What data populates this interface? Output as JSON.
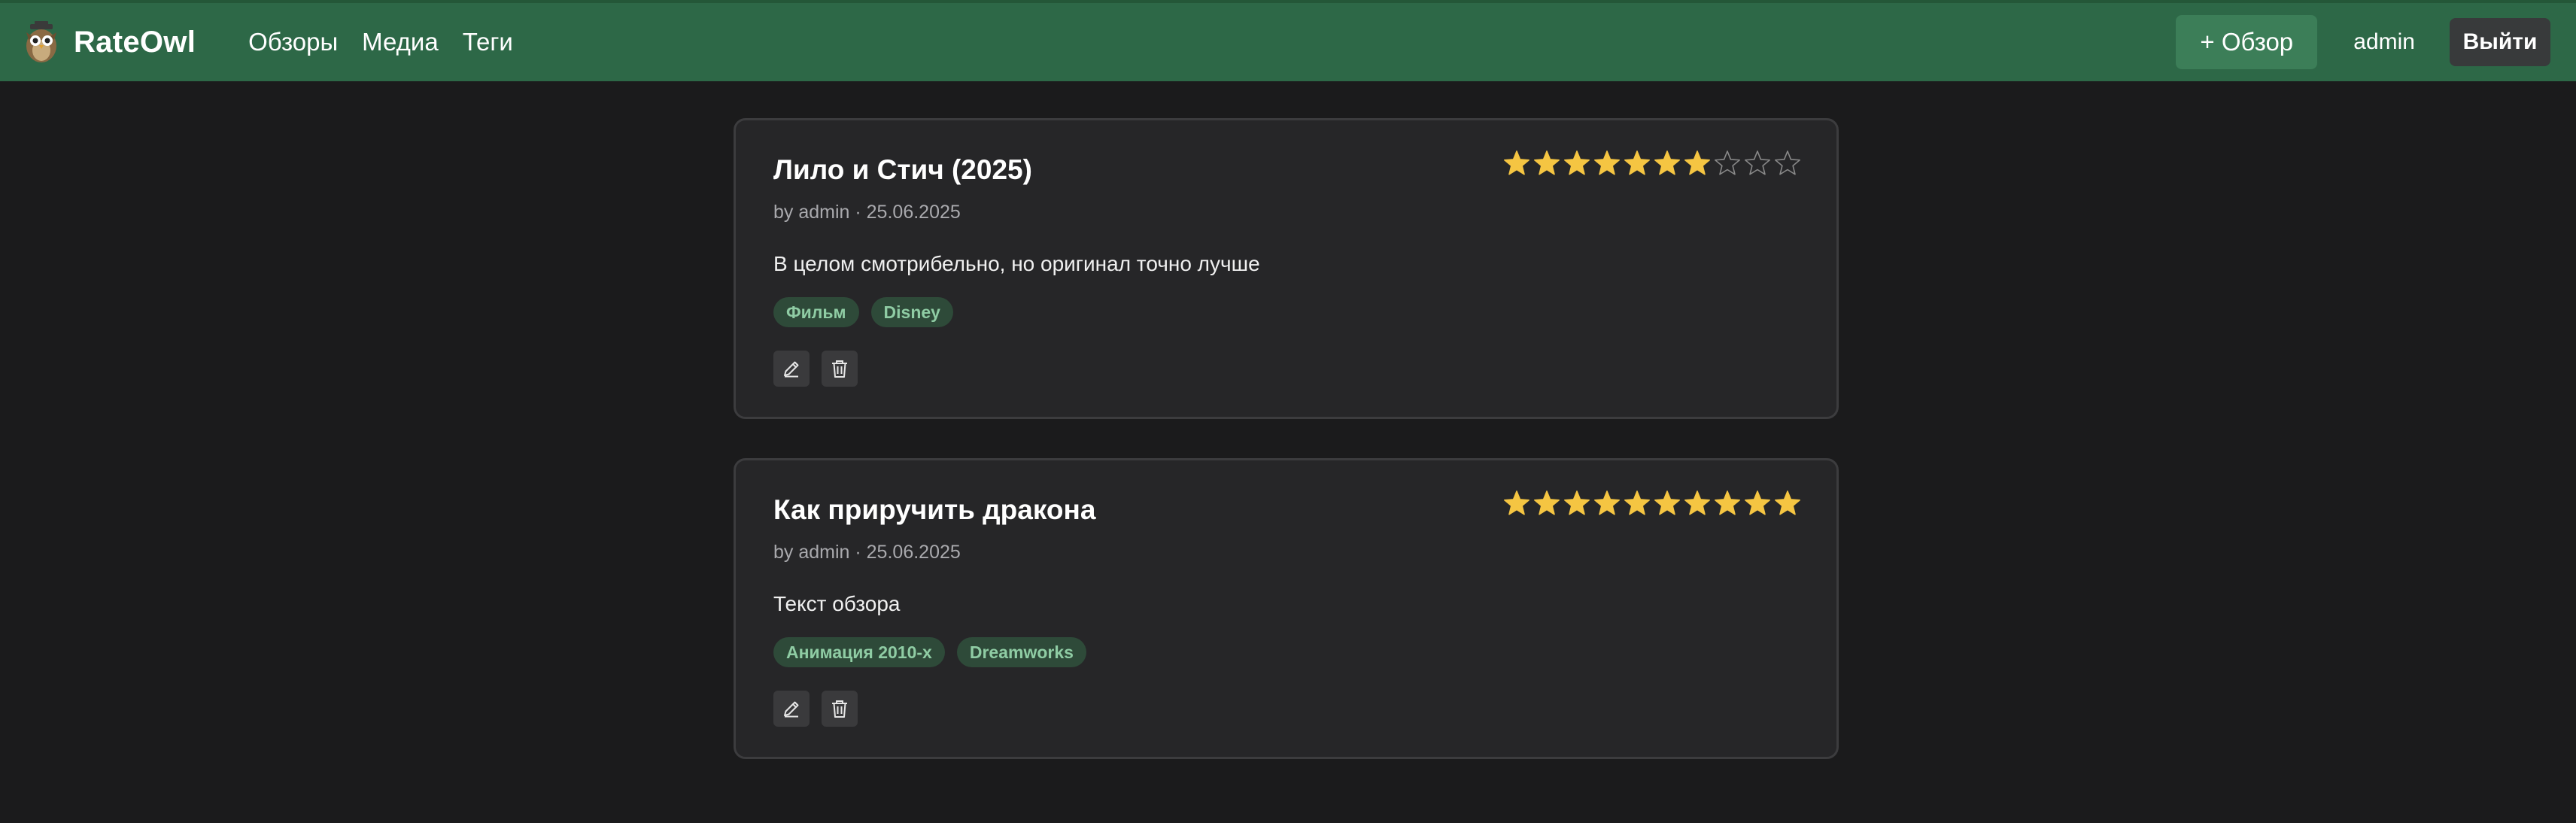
{
  "navbar": {
    "brand": "RateOwl",
    "links": [
      "Обзоры",
      "Медиа",
      "Теги"
    ],
    "add_button": "+ Обзор",
    "username": "admin",
    "logout_button": "Выйти",
    "bg_color": "#2d6847"
  },
  "reviews": [
    {
      "title": "Лило и Стич (2025)",
      "meta": "by admin · 25.06.2025",
      "text": "В целом смотрибельно, но оригинал точно лучше",
      "tags": [
        "Фильм",
        "Disney"
      ],
      "rating": 7,
      "max_rating": 10,
      "edit_icon": "pencil-icon",
      "delete_icon": "trash-icon"
    },
    {
      "title": "Как приручить дракона",
      "meta": "by admin · 25.06.2025",
      "text": "Текст обзора",
      "tags": [
        "Анимация 2010-х",
        "Dreamworks"
      ],
      "rating": 10,
      "max_rating": 10,
      "edit_icon": "pencil-icon",
      "delete_icon": "trash-icon"
    }
  ],
  "colors": {
    "star_filled": "#f5c542",
    "star_empty": "#8a8a8a",
    "tag_bg": "#2e4a39",
    "tag_text": "#8fcca4"
  }
}
